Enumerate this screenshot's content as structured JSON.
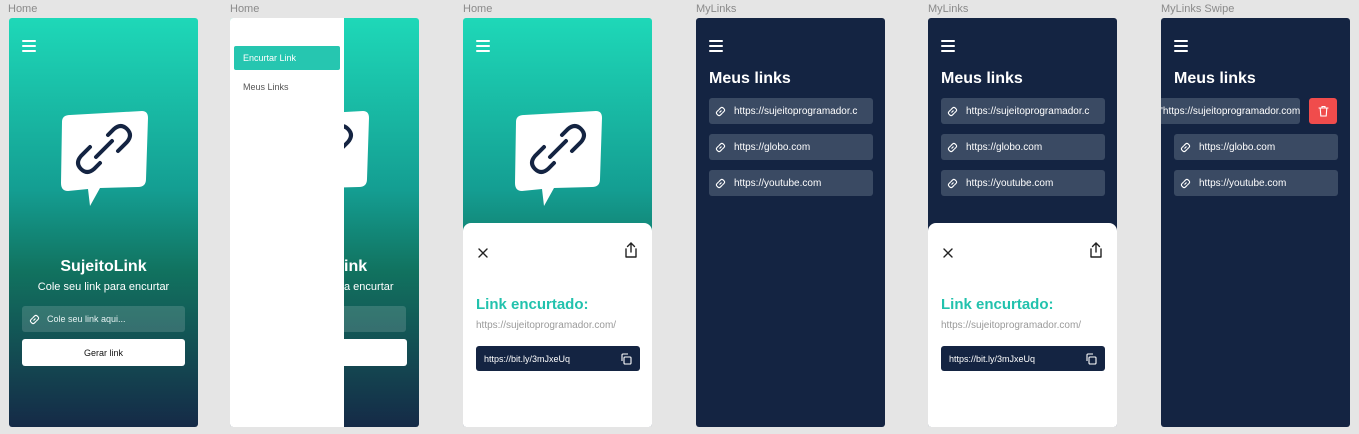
{
  "frames": [
    {
      "label": "Home"
    },
    {
      "label": "Home"
    },
    {
      "label": "Home"
    },
    {
      "label": "MyLinks"
    },
    {
      "label": "MyLinks"
    },
    {
      "label": "MyLinks Swipe"
    }
  ],
  "home": {
    "app_name": "SujeitoLink",
    "subtitle": "Cole seu link para encurtar",
    "input_placeholder": "Cole seu link aqui...",
    "button_label": "Gerar link",
    "partial_title": "ink",
    "partial_subtitle": "a encurtar"
  },
  "drawer": {
    "items": [
      {
        "label": "Encurtar Link"
      },
      {
        "label": "Meus Links"
      }
    ]
  },
  "modal": {
    "title": "Link encurtado:",
    "original_url": "https://sujeitoprogramador.com/",
    "short_url": "https://bit.ly/3mJxeUq"
  },
  "mylinks": {
    "title": "Meus links",
    "links": [
      {
        "url": "https://sujeitoprogramador.c"
      },
      {
        "url": "https://globo.com"
      },
      {
        "url": "https://youtube.com"
      }
    ],
    "swiped_url": "'https://sujeitoprogramador.com"
  },
  "colors": {
    "accent": "#22c2ad",
    "navy": "#142442",
    "delete": "#f04c4c"
  },
  "icons": [
    "menu-icon",
    "chain-link-icon",
    "link-icon",
    "close-icon",
    "share-icon",
    "copy-icon",
    "trash-icon"
  ]
}
